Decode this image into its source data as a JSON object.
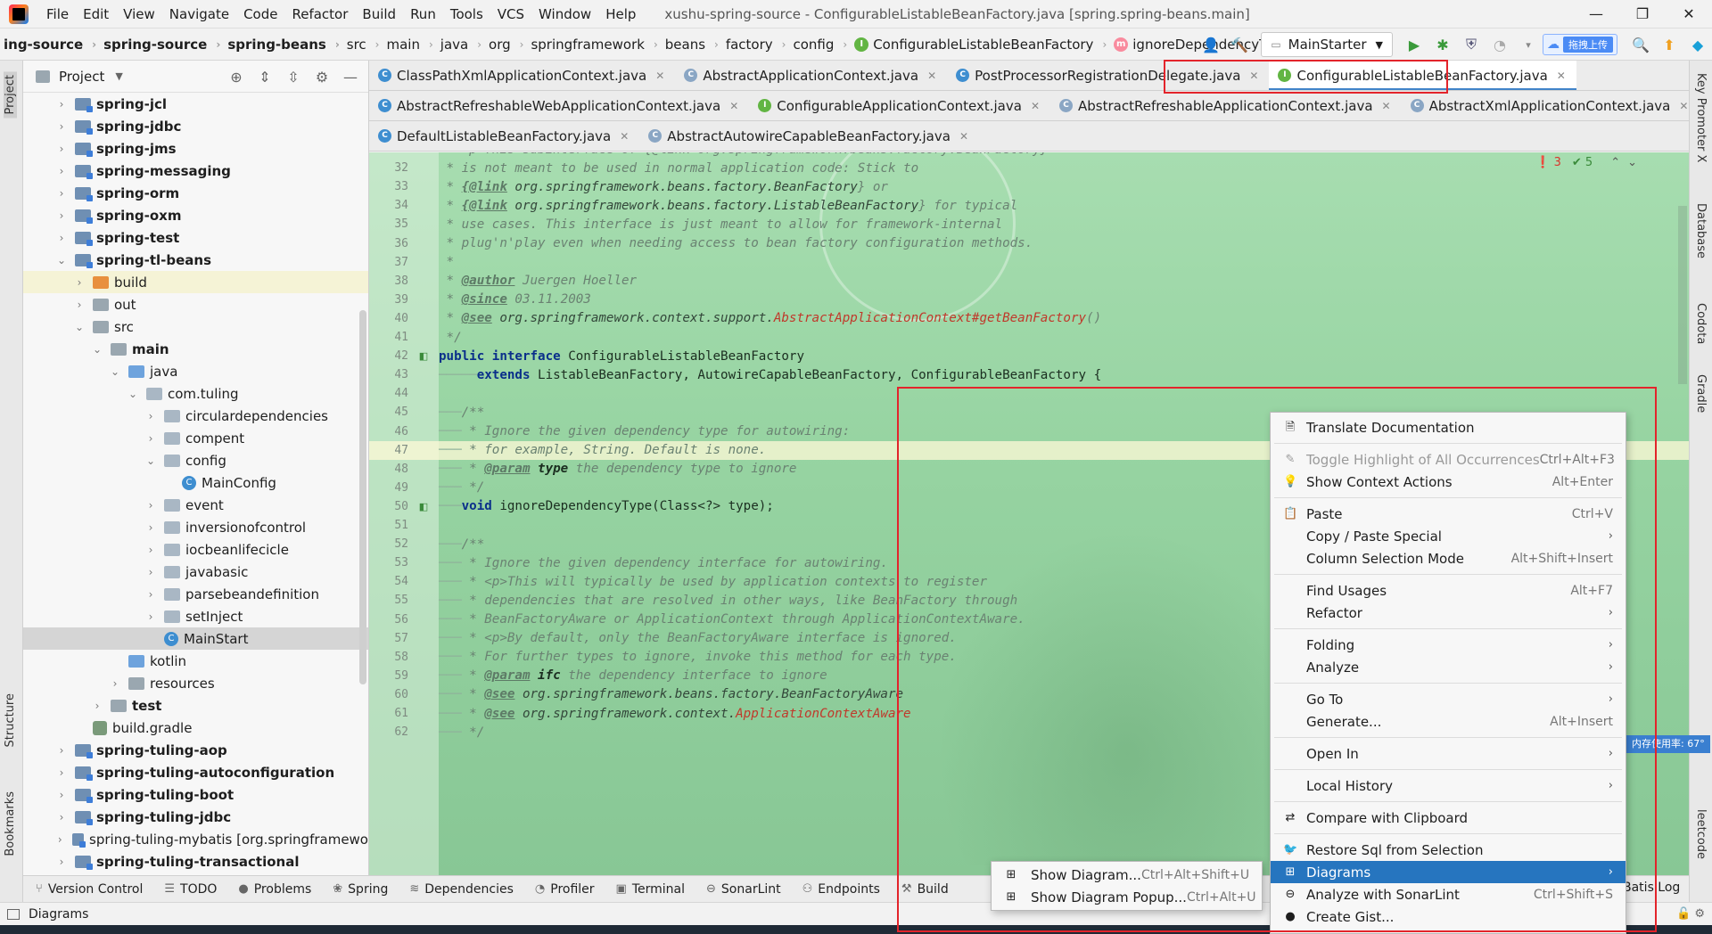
{
  "window": {
    "title": "xushu-spring-source - ConfigurableListableBeanFactory.java [spring.spring-beans.main]",
    "controls": [
      "—",
      "❐",
      "✕"
    ]
  },
  "menu": [
    "File",
    "Edit",
    "View",
    "Navigate",
    "Code",
    "Refactor",
    "Build",
    "Run",
    "Tools",
    "VCS",
    "Window",
    "Help"
  ],
  "breadcrumbs": [
    "ing-source",
    "spring-source",
    "spring-beans",
    "src",
    "main",
    "java",
    "org",
    "springframework",
    "beans",
    "factory",
    "config",
    "ConfigurableListableBeanFactory",
    "ignoreDependencyType"
  ],
  "toolbar": {
    "run_config": "MainStarter",
    "cloud_label": "拖拽上传"
  },
  "project": {
    "title": "Project",
    "tree": [
      {
        "label": "spring-jcl",
        "bold": true,
        "arrow": "›",
        "type": "mod",
        "indent": 0
      },
      {
        "label": "spring-jdbc",
        "bold": true,
        "arrow": "›",
        "type": "mod",
        "indent": 0
      },
      {
        "label": "spring-jms",
        "bold": true,
        "arrow": "›",
        "type": "mod",
        "indent": 0
      },
      {
        "label": "spring-messaging",
        "bold": true,
        "arrow": "›",
        "type": "mod",
        "indent": 0
      },
      {
        "label": "spring-orm",
        "bold": true,
        "arrow": "›",
        "type": "mod",
        "indent": 0
      },
      {
        "label": "spring-oxm",
        "bold": true,
        "arrow": "›",
        "type": "mod",
        "indent": 0
      },
      {
        "label": "spring-test",
        "bold": true,
        "arrow": "›",
        "type": "mod",
        "indent": 0
      },
      {
        "label": "spring-tl-beans",
        "bold": true,
        "arrow": "⌄",
        "type": "mod",
        "indent": 0
      },
      {
        "label": "build",
        "bold": false,
        "arrow": "›",
        "type": "orange",
        "indent": 1,
        "hl": true
      },
      {
        "label": "out",
        "bold": false,
        "arrow": "›",
        "type": "res",
        "indent": 1
      },
      {
        "label": "src",
        "bold": false,
        "arrow": "⌄",
        "type": "res",
        "indent": 1
      },
      {
        "label": "main",
        "bold": true,
        "arrow": "⌄",
        "type": "res",
        "indent": 2
      },
      {
        "label": "java",
        "bold": false,
        "arrow": "⌄",
        "type": "blue",
        "indent": 3
      },
      {
        "label": "com.tuling",
        "bold": false,
        "arrow": "⌄",
        "type": "pkg",
        "indent": 4
      },
      {
        "label": "circulardependencies",
        "bold": false,
        "arrow": "›",
        "type": "pkg",
        "indent": 5
      },
      {
        "label": "compent",
        "bold": false,
        "arrow": "›",
        "type": "pkg",
        "indent": 5
      },
      {
        "label": "config",
        "bold": false,
        "arrow": "⌄",
        "type": "pkg",
        "indent": 5
      },
      {
        "label": "MainConfig",
        "bold": false,
        "arrow": "",
        "type": "cls",
        "indent": 6
      },
      {
        "label": "event",
        "bold": false,
        "arrow": "›",
        "type": "pkg",
        "indent": 5
      },
      {
        "label": "inversionofcontrol",
        "bold": false,
        "arrow": "›",
        "type": "pkg",
        "indent": 5
      },
      {
        "label": "iocbeanlifecicle",
        "bold": false,
        "arrow": "›",
        "type": "pkg",
        "indent": 5
      },
      {
        "label": "javabasic",
        "bold": false,
        "arrow": "›",
        "type": "pkg",
        "indent": 5
      },
      {
        "label": "parsebeandefinition",
        "bold": false,
        "arrow": "›",
        "type": "pkg",
        "indent": 5
      },
      {
        "label": "setInject",
        "bold": false,
        "arrow": "›",
        "type": "pkg",
        "indent": 5
      },
      {
        "label": "MainStart",
        "bold": false,
        "arrow": "",
        "type": "cls",
        "indent": 5,
        "sel": true
      },
      {
        "label": "kotlin",
        "bold": false,
        "arrow": "",
        "type": "blue",
        "indent": 3
      },
      {
        "label": "resources",
        "bold": false,
        "arrow": "›",
        "type": "res",
        "indent": 3
      },
      {
        "label": "test",
        "bold": true,
        "arrow": "›",
        "type": "res",
        "indent": 2
      },
      {
        "label": "build.gradle",
        "bold": false,
        "arrow": "",
        "type": "gradle",
        "indent": 1
      },
      {
        "label": "spring-tuling-aop",
        "bold": true,
        "arrow": "›",
        "type": "mod",
        "indent": 0
      },
      {
        "label": "spring-tuling-autoconfiguration",
        "bold": true,
        "arrow": "›",
        "type": "mod",
        "indent": 0
      },
      {
        "label": "spring-tuling-boot",
        "bold": true,
        "arrow": "›",
        "type": "mod",
        "indent": 0
      },
      {
        "label": "spring-tuling-jdbc",
        "bold": true,
        "arrow": "›",
        "type": "mod",
        "indent": 0
      },
      {
        "label": "spring-tuling-mybatis [org.springframewo",
        "bold": false,
        "arrow": "›",
        "type": "mod",
        "indent": 0
      },
      {
        "label": "spring-tuling-transactional",
        "bold": true,
        "arrow": "›",
        "type": "mod",
        "indent": 0
      }
    ]
  },
  "tabs": [
    [
      {
        "label": "ClassPathXmlApplicationContext.java",
        "icon": "c"
      },
      {
        "label": "AbstractApplicationContext.java",
        "icon": "a"
      },
      {
        "label": "PostProcessorRegistrationDelegate.java",
        "icon": "c"
      },
      {
        "label": "ConfigurableListableBeanFactory.java",
        "icon": "i",
        "active": true
      }
    ],
    [
      {
        "label": "AbstractRefreshableWebApplicationContext.java",
        "icon": "c"
      },
      {
        "label": "ConfigurableApplicationContext.java",
        "icon": "i"
      },
      {
        "label": "AbstractRefreshableApplicationContext.java",
        "icon": "a"
      },
      {
        "label": "AbstractXmlApplicationContext.java",
        "icon": "a"
      }
    ],
    [
      {
        "label": "DefaultListableBeanFactory.java",
        "icon": "c"
      },
      {
        "label": "AbstractAutowireCapableBeanFactory.java",
        "icon": "a"
      }
    ]
  ],
  "inspections": {
    "errors": "3",
    "ok": "5"
  },
  "memory": "内存使用率: 67°",
  "code": [
    {
      "n": "31",
      "t": "cm",
      "s": " * <p>This subinterface of {@link org.springframework.beans.factory.BeanFactory}"
    },
    {
      "n": "32",
      "t": "cm",
      "s": " * is not meant to be used in normal application code: Stick to"
    },
    {
      "n": "33",
      "t": "link",
      "pre": " * ",
      "tag": "{@link",
      "lnk": " org.springframework.beans.factory.BeanFactory",
      "post": "} or"
    },
    {
      "n": "34",
      "t": "link",
      "pre": " * ",
      "tag": "{@link",
      "lnk": " org.springframework.beans.factory.ListableBeanFactory",
      "post": "} for typical"
    },
    {
      "n": "35",
      "t": "cm",
      "s": " * use cases. This interface is just meant to allow for framework-internal"
    },
    {
      "n": "36",
      "t": "cm",
      "s": " * plug'n'play even when needing access to bean factory configuration methods."
    },
    {
      "n": "37",
      "t": "cm",
      "s": " *"
    },
    {
      "n": "38",
      "t": "tagline",
      "pre": " * ",
      "tag": "@author",
      "post": " Juergen Hoeller"
    },
    {
      "n": "39",
      "t": "tagline",
      "pre": " * ",
      "tag": "@since",
      "post": " 03.11.2003"
    },
    {
      "n": "40",
      "t": "see",
      "pre": " * ",
      "tag": "@see",
      "lnk": " org.springframework.context.support.",
      "red": "AbstractApplicationContext#getBeanFactory",
      "post": "()"
    },
    {
      "n": "41",
      "t": "cm",
      "s": " */"
    },
    {
      "n": "42",
      "t": "decl1",
      "icon": "◧"
    },
    {
      "n": "43",
      "t": "decl2"
    },
    {
      "n": "44",
      "t": "empty"
    },
    {
      "n": "45",
      "t": "icm",
      "s": "/**"
    },
    {
      "n": "46",
      "t": "icm",
      "s": " * Ignore the given dependency type for autowiring:"
    },
    {
      "n": "47",
      "t": "icm",
      "s": " * for example, String. Default is none.",
      "cur": true
    },
    {
      "n": "48",
      "t": "iparam",
      "tag": "@param",
      "pn": " type",
      "post": " the dependency type to ignore"
    },
    {
      "n": "49",
      "t": "icm",
      "s": " */"
    },
    {
      "n": "50",
      "t": "method",
      "icon": "◧"
    },
    {
      "n": "51",
      "t": "empty"
    },
    {
      "n": "52",
      "t": "icm",
      "s": "/**"
    },
    {
      "n": "53",
      "t": "icm",
      "s": " * Ignore the given dependency interface for autowiring."
    },
    {
      "n": "54",
      "t": "icm",
      "s": " * <p>This will typically be used by application contexts to register"
    },
    {
      "n": "55",
      "t": "icm",
      "s": " * dependencies that are resolved in other ways, like BeanFactory through"
    },
    {
      "n": "56",
      "t": "icm",
      "s": " * BeanFactoryAware or ApplicationContext through ApplicationContextAware."
    },
    {
      "n": "57",
      "t": "icm",
      "s": " * <p>By default, only the BeanFactoryAware interface is ignored."
    },
    {
      "n": "58",
      "t": "icm",
      "s": " * For further types to ignore, invoke this method for each type."
    },
    {
      "n": "59",
      "t": "iparam",
      "tag": "@param",
      "pn": " ifc",
      "post": " the dependency interface to ignore"
    },
    {
      "n": "60",
      "t": "isee",
      "tag": "@see",
      "lnk": " org.springframework.beans.factory.BeanFactoryAware",
      "red": ""
    },
    {
      "n": "61",
      "t": "isee",
      "tag": "@see",
      "lnk": " org.springframework.context.",
      "red": "ApplicationContextAware"
    },
    {
      "n": "62",
      "t": "icm",
      "s": " */"
    }
  ],
  "decl": {
    "kw1": "public",
    "kw2": "interface",
    "name": " ConfigurableListableBeanFactory",
    "ext": "extends",
    "supers": " ListableBeanFactory, AutowireCapableBeanFactory, ConfigurableBeanFactory {",
    "mkw": "void",
    "msig": " ignoreDependencyType(Class<?> type);"
  },
  "context_menu": [
    {
      "label": "Translate Documentation",
      "icon": "🗎",
      "sc": ""
    },
    {
      "sep": true
    },
    {
      "label": "Toggle Highlight of All Occurrences",
      "icon": "✎",
      "sc": "Ctrl+Alt+F3",
      "dis": true
    },
    {
      "label": "Show Context Actions",
      "icon": "💡",
      "sc": "Alt+Enter"
    },
    {
      "sep": true
    },
    {
      "label": "Paste",
      "icon": "📋",
      "sc": "Ctrl+V"
    },
    {
      "label": "Copy / Paste Special",
      "sub": true
    },
    {
      "label": "Column Selection Mode",
      "sc": "Alt+Shift+Insert"
    },
    {
      "sep": true
    },
    {
      "label": "Find Usages",
      "sc": "Alt+F7"
    },
    {
      "label": "Refactor",
      "sub": true
    },
    {
      "sep": true
    },
    {
      "label": "Folding",
      "sub": true
    },
    {
      "label": "Analyze",
      "sub": true
    },
    {
      "sep": true
    },
    {
      "label": "Go To",
      "sub": true
    },
    {
      "label": "Generate...",
      "sc": "Alt+Insert"
    },
    {
      "sep": true
    },
    {
      "label": "Open In",
      "sub": true
    },
    {
      "sep": true
    },
    {
      "label": "Local History",
      "sub": true
    },
    {
      "sep": true
    },
    {
      "label": "Compare with Clipboard",
      "icon": "⇄",
      "sc": ""
    },
    {
      "sep": true
    },
    {
      "label": "Restore Sql from Selection",
      "icon": "🐦",
      "sc": ""
    },
    {
      "label": "Diagrams",
      "icon": "⊞",
      "sub": true,
      "act": true
    },
    {
      "label": "Analyze with SonarLint",
      "icon": "⊖",
      "sc": "Ctrl+Shift+S"
    },
    {
      "label": "Create Gist...",
      "icon": "●",
      "sc": ""
    }
  ],
  "submenu": [
    {
      "label": "Show Diagram...",
      "sc": "Ctrl+Alt+Shift+U"
    },
    {
      "label": "Show Diagram Popup...",
      "sc": "Ctrl+Alt+U"
    }
  ],
  "bottom_tools": [
    {
      "label": "Version Control",
      "icon": "⑂"
    },
    {
      "label": "TODO",
      "icon": "☰"
    },
    {
      "label": "Problems",
      "icon": "●"
    },
    {
      "label": "Spring",
      "icon": "❀"
    },
    {
      "label": "Dependencies",
      "icon": "≋"
    },
    {
      "label": "Profiler",
      "icon": "◔"
    },
    {
      "label": "Terminal",
      "icon": "▣"
    },
    {
      "label": "SonarLint",
      "icon": "⊖"
    },
    {
      "label": "Endpoints",
      "icon": "⚇"
    },
    {
      "label": "Build",
      "icon": "⚒"
    }
  ],
  "bottom_right": "Batis Log",
  "status": {
    "text": "Diagrams"
  },
  "left_labels": [
    "Project",
    "Structure",
    "Bookmarks"
  ],
  "right_labels": [
    "Key Promoter X",
    "Database",
    "Codota",
    "Gradle",
    "leetcode"
  ]
}
